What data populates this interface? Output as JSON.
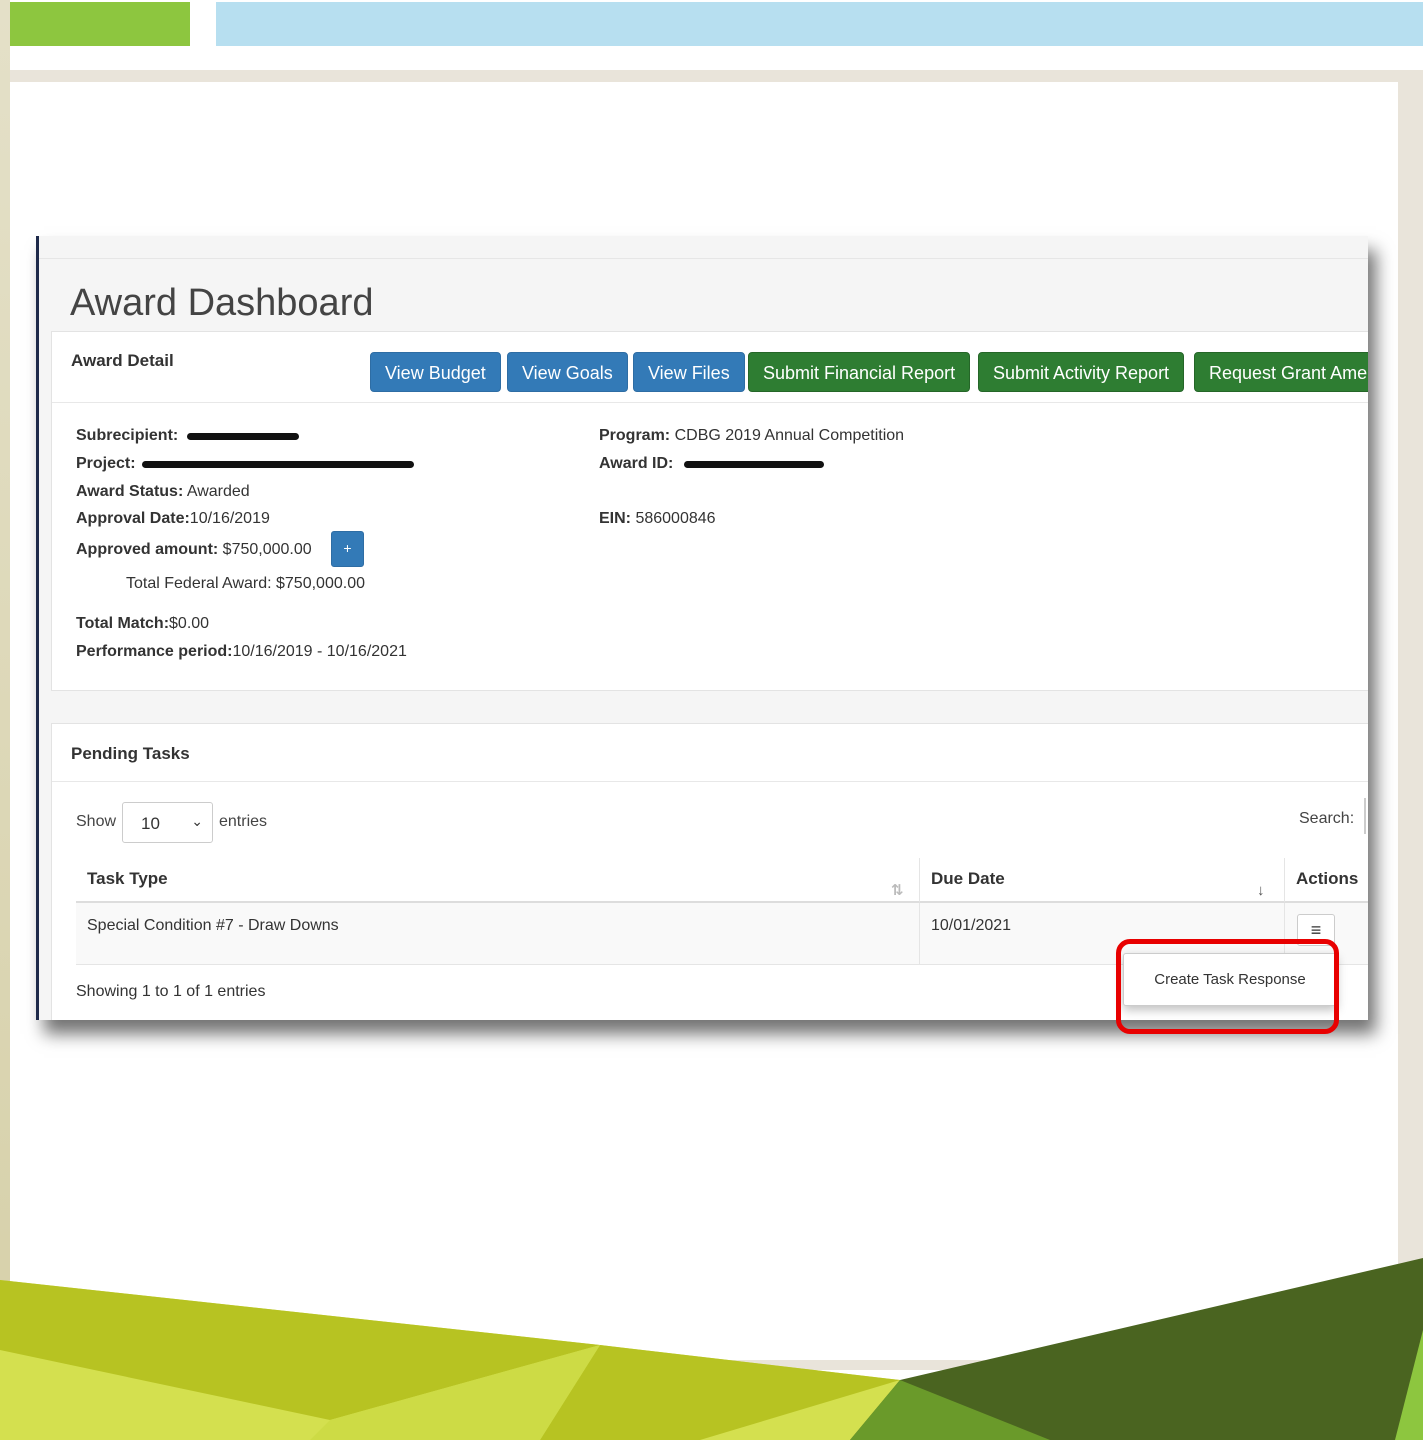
{
  "page": {
    "title": "Award Dashboard"
  },
  "award_detail": {
    "section_title": "Award Detail",
    "buttons": [
      {
        "label": "View Budget",
        "color": "#337ab7"
      },
      {
        "label": "View Goals",
        "color": "#337ab7"
      },
      {
        "label": "View Files",
        "color": "#337ab7"
      },
      {
        "label": "Submit Financial Report",
        "color": "#2e7d32"
      },
      {
        "label": "Submit Activity Report",
        "color": "#2e7d32"
      },
      {
        "label": "Request Grant Ame",
        "color": "#2e7d32"
      }
    ],
    "left_fields": {
      "subrecipient_label": "Subrecipient:",
      "project_label": "Project:",
      "award_status_label": "Award Status:",
      "award_status_value": "Awarded",
      "approval_date_label": "Approval Date:",
      "approval_date_value": "10/16/2019",
      "approved_amount_label": "Approved amount:",
      "approved_amount_value": "$750,000.00",
      "expand_button": "+",
      "total_federal_award": "Total Federal Award: $750,000.00",
      "total_match_label": "Total Match:",
      "total_match_value": "$0.00",
      "performance_period_label": "Performance period:",
      "performance_period_value": "10/16/2019 - 10/16/2021"
    },
    "right_fields": {
      "program_label": "Program:",
      "program_value": "CDBG 2019 Annual Competition",
      "award_id_label": "Award ID:",
      "ein_label": "EIN:",
      "ein_value": "586000846"
    }
  },
  "pending_tasks": {
    "section_title": "Pending Tasks",
    "show_label": "Show",
    "entries_value": "10",
    "entries_label": "entries",
    "search_label": "Search:",
    "columns": [
      "Task Type",
      "Due Date",
      "Actions"
    ],
    "rows": [
      {
        "task_type": "Special Condition #7 - Draw Downs",
        "due_date": "10/01/2021"
      }
    ],
    "showing_text": "Showing 1 to 1 of 1 entries",
    "menu_icon": "≡",
    "dropdown_item": "Create Task Response"
  },
  "colors": {
    "highlight": "#e80000",
    "primary_blue": "#337ab7",
    "success_green": "#2e7d32"
  }
}
